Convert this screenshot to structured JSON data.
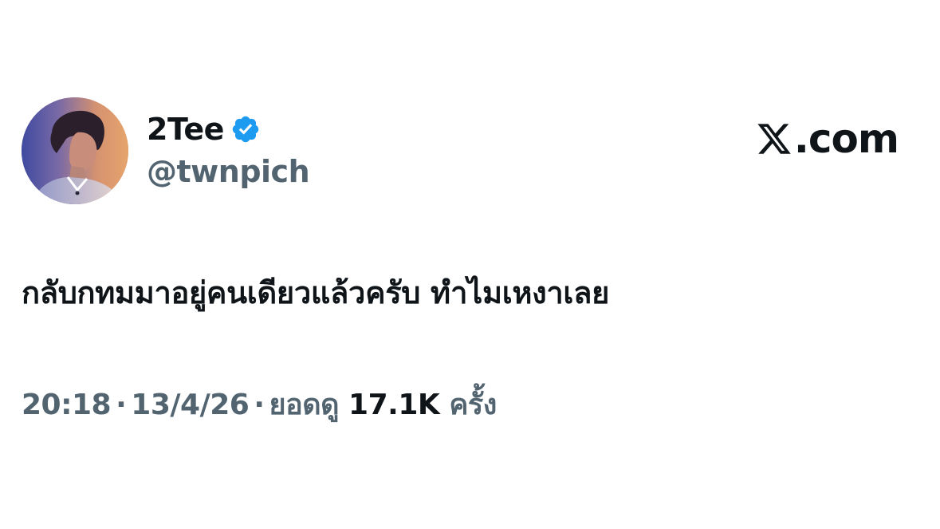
{
  "author": {
    "display_name": "2Tee",
    "handle": "@twnpich",
    "verified": true,
    "avatar_icon": "profile-photo"
  },
  "site": {
    "label": ".com",
    "logo_icon": "x-logo-icon"
  },
  "tweet": {
    "text": "กลับกทมมาอยู่คนเดียวแล้วครับ ทำไมเหงาเลย"
  },
  "meta": {
    "time": "20:18",
    "separator": "·",
    "date": "13/4/26",
    "views_prefix": "ยอดดู",
    "views_count": "17.1K",
    "views_suffix": "ครั้ง"
  },
  "colors": {
    "text_primary": "#0f1419",
    "text_secondary": "#536471",
    "verified_blue": "#1d9bf0",
    "background": "#ffffff"
  }
}
